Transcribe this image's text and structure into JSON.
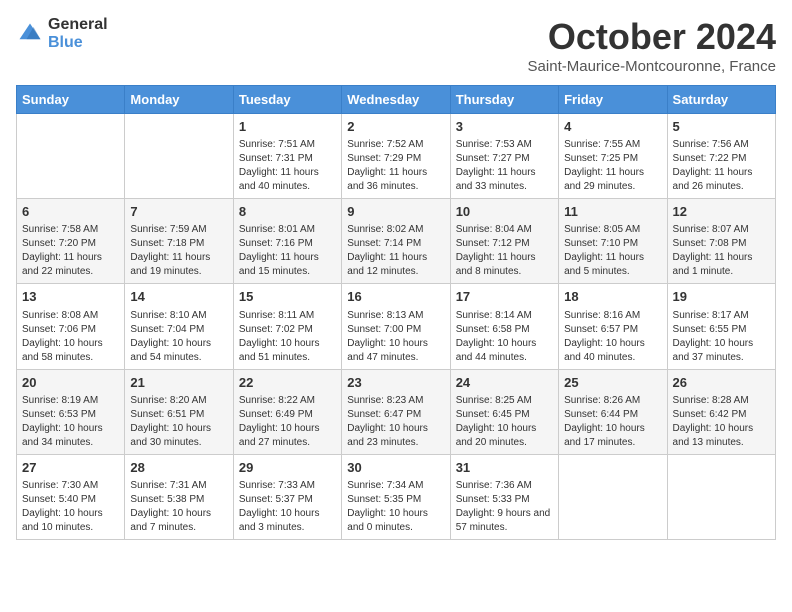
{
  "logo": {
    "general": "General",
    "blue": "Blue"
  },
  "header": {
    "title": "October 2024",
    "location": "Saint-Maurice-Montcouronne, France"
  },
  "weekdays": [
    "Sunday",
    "Monday",
    "Tuesday",
    "Wednesday",
    "Thursday",
    "Friday",
    "Saturday"
  ],
  "weeks": [
    [
      {
        "day": "",
        "info": ""
      },
      {
        "day": "",
        "info": ""
      },
      {
        "day": "1",
        "info": "Sunrise: 7:51 AM\nSunset: 7:31 PM\nDaylight: 11 hours and 40 minutes."
      },
      {
        "day": "2",
        "info": "Sunrise: 7:52 AM\nSunset: 7:29 PM\nDaylight: 11 hours and 36 minutes."
      },
      {
        "day": "3",
        "info": "Sunrise: 7:53 AM\nSunset: 7:27 PM\nDaylight: 11 hours and 33 minutes."
      },
      {
        "day": "4",
        "info": "Sunrise: 7:55 AM\nSunset: 7:25 PM\nDaylight: 11 hours and 29 minutes."
      },
      {
        "day": "5",
        "info": "Sunrise: 7:56 AM\nSunset: 7:22 PM\nDaylight: 11 hours and 26 minutes."
      }
    ],
    [
      {
        "day": "6",
        "info": "Sunrise: 7:58 AM\nSunset: 7:20 PM\nDaylight: 11 hours and 22 minutes."
      },
      {
        "day": "7",
        "info": "Sunrise: 7:59 AM\nSunset: 7:18 PM\nDaylight: 11 hours and 19 minutes."
      },
      {
        "day": "8",
        "info": "Sunrise: 8:01 AM\nSunset: 7:16 PM\nDaylight: 11 hours and 15 minutes."
      },
      {
        "day": "9",
        "info": "Sunrise: 8:02 AM\nSunset: 7:14 PM\nDaylight: 11 hours and 12 minutes."
      },
      {
        "day": "10",
        "info": "Sunrise: 8:04 AM\nSunset: 7:12 PM\nDaylight: 11 hours and 8 minutes."
      },
      {
        "day": "11",
        "info": "Sunrise: 8:05 AM\nSunset: 7:10 PM\nDaylight: 11 hours and 5 minutes."
      },
      {
        "day": "12",
        "info": "Sunrise: 8:07 AM\nSunset: 7:08 PM\nDaylight: 11 hours and 1 minute."
      }
    ],
    [
      {
        "day": "13",
        "info": "Sunrise: 8:08 AM\nSunset: 7:06 PM\nDaylight: 10 hours and 58 minutes."
      },
      {
        "day": "14",
        "info": "Sunrise: 8:10 AM\nSunset: 7:04 PM\nDaylight: 10 hours and 54 minutes."
      },
      {
        "day": "15",
        "info": "Sunrise: 8:11 AM\nSunset: 7:02 PM\nDaylight: 10 hours and 51 minutes."
      },
      {
        "day": "16",
        "info": "Sunrise: 8:13 AM\nSunset: 7:00 PM\nDaylight: 10 hours and 47 minutes."
      },
      {
        "day": "17",
        "info": "Sunrise: 8:14 AM\nSunset: 6:58 PM\nDaylight: 10 hours and 44 minutes."
      },
      {
        "day": "18",
        "info": "Sunrise: 8:16 AM\nSunset: 6:57 PM\nDaylight: 10 hours and 40 minutes."
      },
      {
        "day": "19",
        "info": "Sunrise: 8:17 AM\nSunset: 6:55 PM\nDaylight: 10 hours and 37 minutes."
      }
    ],
    [
      {
        "day": "20",
        "info": "Sunrise: 8:19 AM\nSunset: 6:53 PM\nDaylight: 10 hours and 34 minutes."
      },
      {
        "day": "21",
        "info": "Sunrise: 8:20 AM\nSunset: 6:51 PM\nDaylight: 10 hours and 30 minutes."
      },
      {
        "day": "22",
        "info": "Sunrise: 8:22 AM\nSunset: 6:49 PM\nDaylight: 10 hours and 27 minutes."
      },
      {
        "day": "23",
        "info": "Sunrise: 8:23 AM\nSunset: 6:47 PM\nDaylight: 10 hours and 23 minutes."
      },
      {
        "day": "24",
        "info": "Sunrise: 8:25 AM\nSunset: 6:45 PM\nDaylight: 10 hours and 20 minutes."
      },
      {
        "day": "25",
        "info": "Sunrise: 8:26 AM\nSunset: 6:44 PM\nDaylight: 10 hours and 17 minutes."
      },
      {
        "day": "26",
        "info": "Sunrise: 8:28 AM\nSunset: 6:42 PM\nDaylight: 10 hours and 13 minutes."
      }
    ],
    [
      {
        "day": "27",
        "info": "Sunrise: 7:30 AM\nSunset: 5:40 PM\nDaylight: 10 hours and 10 minutes."
      },
      {
        "day": "28",
        "info": "Sunrise: 7:31 AM\nSunset: 5:38 PM\nDaylight: 10 hours and 7 minutes."
      },
      {
        "day": "29",
        "info": "Sunrise: 7:33 AM\nSunset: 5:37 PM\nDaylight: 10 hours and 3 minutes."
      },
      {
        "day": "30",
        "info": "Sunrise: 7:34 AM\nSunset: 5:35 PM\nDaylight: 10 hours and 0 minutes."
      },
      {
        "day": "31",
        "info": "Sunrise: 7:36 AM\nSunset: 5:33 PM\nDaylight: 9 hours and 57 minutes."
      },
      {
        "day": "",
        "info": ""
      },
      {
        "day": "",
        "info": ""
      }
    ]
  ]
}
